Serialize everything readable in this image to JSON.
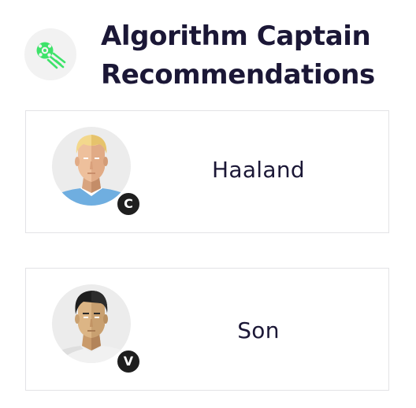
{
  "header": {
    "title_line1": "Algorithm Captain",
    "title_line2": "Recommendations",
    "logo_icon": "football-rocket-icon",
    "accent_color": "#3ee36a"
  },
  "recommendations": [
    {
      "role": "captain",
      "badge": "C",
      "name": "Haaland",
      "avatar_icon": "player-avatar-icon",
      "shirt_color": "#6faee0"
    },
    {
      "role": "vice-captain",
      "badge": "V",
      "name": "Son",
      "avatar_icon": "player-avatar-icon",
      "shirt_color": "#f1f1f1"
    }
  ]
}
